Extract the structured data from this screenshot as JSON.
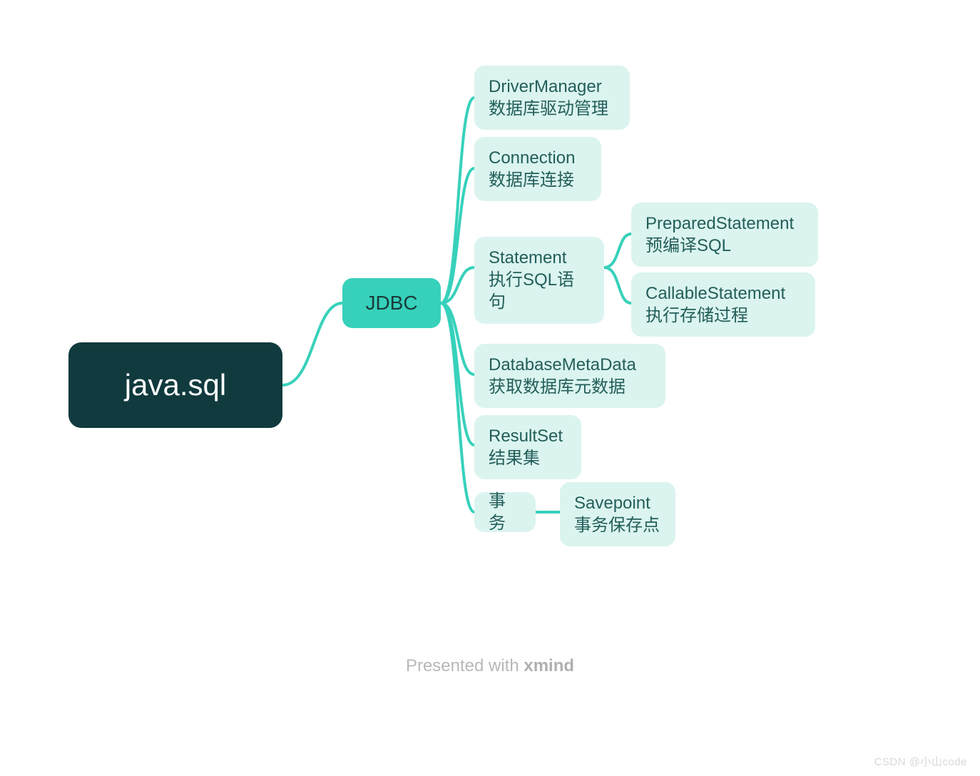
{
  "root": {
    "label": "java.sql"
  },
  "level1": {
    "label": "JDBC"
  },
  "level2": [
    {
      "title": "DriverManager",
      "subtitle": "数据库驱动管理"
    },
    {
      "title": "Connection",
      "subtitle": "数据库连接"
    },
    {
      "title": "Statement",
      "subtitle": "执行SQL语句"
    },
    {
      "title": "DatabaseMetaData",
      "subtitle": "获取数据库元数据"
    },
    {
      "title": "ResultSet",
      "subtitle": "结果集"
    },
    {
      "title": "事务",
      "subtitle": ""
    }
  ],
  "statement_children": [
    {
      "title": "PreparedStatement",
      "subtitle": "预编译SQL"
    },
    {
      "title": "CallableStatement",
      "subtitle": "执行存储过程"
    }
  ],
  "transaction_children": [
    {
      "title": "Savepoint",
      "subtitle": "事务保存点"
    }
  ],
  "footer": {
    "prefix": "Presented with ",
    "brand": "xmind"
  },
  "watermark": "CSDN @小山code",
  "colors": {
    "root_bg": "#103a3d",
    "accent": "#37d1bb",
    "leaf_bg": "#dbf4ef",
    "text_dark": "#235e5a"
  }
}
